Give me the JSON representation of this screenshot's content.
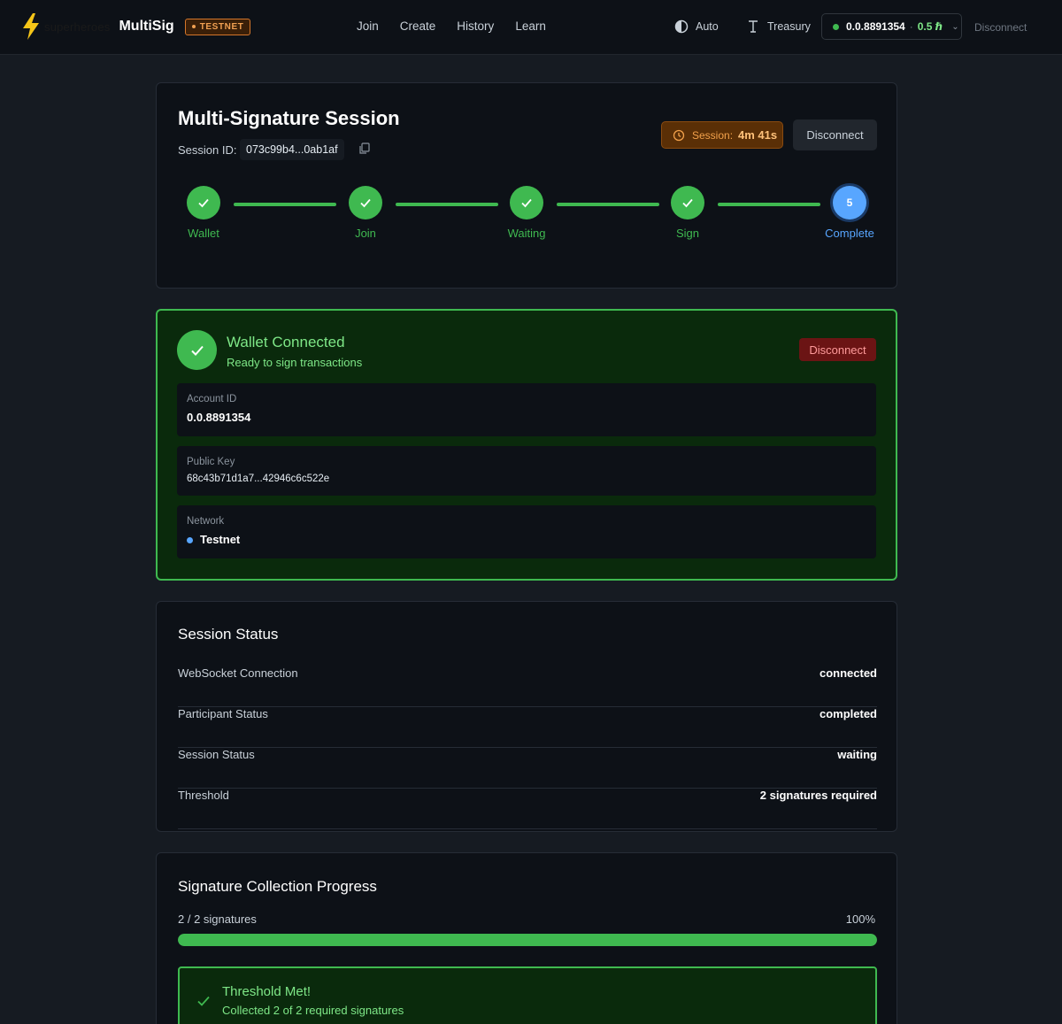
{
  "nav": {
    "brand_sub": "superheroes",
    "brand_name": "MultiSig",
    "network_badge": "TESTNET",
    "links": [
      "Join",
      "Create",
      "History",
      "Learn"
    ],
    "theme_label": "Auto",
    "treasury_label": "Treasury",
    "account": "0.0.8891354",
    "balance": "0.5 ℏ",
    "disconnect_label": "Disconnect"
  },
  "session": {
    "title": "Multi-Signature Session",
    "id_label": "Session ID:",
    "id_value": "073c99b4...0ab1af",
    "timer_label": "Session:",
    "timer_value": "4m 41s",
    "disconnect_label": "Disconnect",
    "steps": [
      {
        "label": "Wallet",
        "state": "done"
      },
      {
        "label": "Join",
        "state": "done"
      },
      {
        "label": "Waiting",
        "state": "done"
      },
      {
        "label": "Sign",
        "state": "done"
      },
      {
        "label": "Complete",
        "state": "active",
        "number": "5"
      }
    ]
  },
  "wallet": {
    "title": "Wallet Connected",
    "subtitle": "Ready to sign transactions",
    "disconnect_label": "Disconnect",
    "account_label": "Account ID",
    "account_value": "0.0.8891354",
    "pubkey_label": "Public Key",
    "pubkey_value": "68c43b71d1a7...42946c6c522e",
    "network_label": "Network",
    "network_value": "Testnet"
  },
  "status": {
    "title": "Session Status",
    "rows": [
      {
        "key": "WebSocket Connection",
        "value": "connected"
      },
      {
        "key": "Participant Status",
        "value": "completed"
      },
      {
        "key": "Session Status",
        "value": "waiting"
      },
      {
        "key": "Threshold",
        "value": "2 signatures required"
      }
    ]
  },
  "signatures": {
    "title": "Signature Collection Progress",
    "count_text": "2 / 2 signatures",
    "percent_text": "100%",
    "progress": 1.0,
    "threshold_title": "Threshold Met!",
    "threshold_sub": "Collected 2 of 2 required signatures"
  },
  "colors": {
    "success": "#3fb950",
    "active": "#58a6ff",
    "warning": "#f2a14b",
    "danger": "#6b1414"
  }
}
